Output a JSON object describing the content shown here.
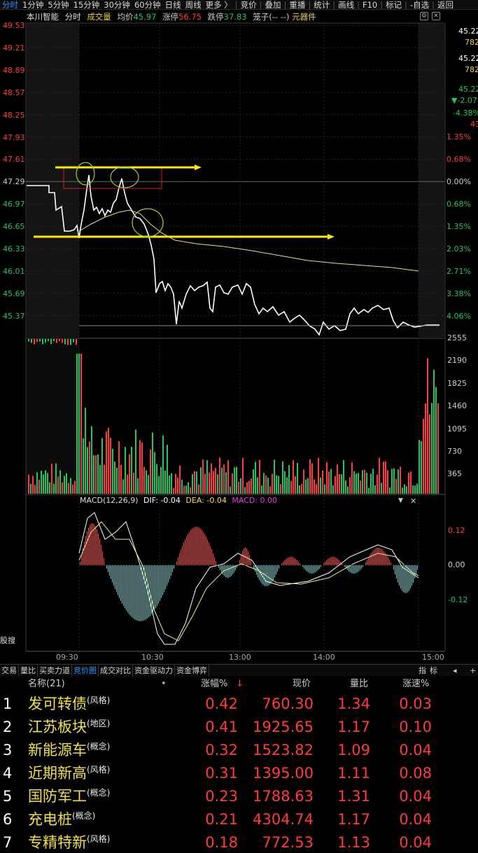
{
  "topbar": {
    "tabs": [
      "分时",
      "1分钟",
      "5分钟",
      "15分钟",
      "30分钟",
      "60分钟",
      "日线",
      "周线",
      "更多 〉",
      "竞价",
      "叠加",
      "重播",
      "统计",
      "画线",
      "F10",
      "标记",
      "-自选",
      "返回"
    ]
  },
  "info": {
    "stock_name": "本川智能",
    "mode": "分时",
    "volume_label": "成交量",
    "avg_label": "均价",
    "avg_value": "45.97",
    "limit_up_label": "涨停",
    "limit_up_value": "56.75",
    "limit_down_label": "跌停",
    "limit_down_value": "37.83",
    "chip_label": "笼子(-- --)",
    "sector": "元器件"
  },
  "price_axis": [
    "49.53",
    "49.21",
    "48.89",
    "48.57",
    "48.25",
    "47.93",
    "47.61",
    "47.29",
    "46.97",
    "46.65",
    "46.33",
    "46.01",
    "45.69",
    "45.37"
  ],
  "pct_axis": [
    "1.35%",
    "0.68%",
    "0.00%",
    "0.68%",
    "1.35%",
    "2.03%",
    "2.71%",
    "3.38%",
    "4.06%"
  ],
  "volume_axis": [
    "2555",
    "2190",
    "1825",
    "1460",
    "1095",
    "730",
    "365"
  ],
  "right_panel": {
    "p1": "45.22",
    "p1_sub": "782",
    "p2": "45.22",
    "p2_sub": "782",
    "p3": "45.22",
    "p3_change": "▼-2.07",
    "p3_pct": "-4.38%",
    "p3_sub": "43"
  },
  "macd": {
    "title": "MACD(12,26,9)",
    "dif_label": "DIF: -0.04",
    "dea_label": "DEA: -0.04",
    "macd_label": "MACD: 0.00",
    "axis": [
      "0.12",
      "0.00",
      "-0.12"
    ]
  },
  "side_label": "股搜",
  "time_axis": [
    "09:30",
    "10:30",
    "13:00",
    "14:00",
    "15:00"
  ],
  "bottom_right_buttons": [
    "指",
    "标"
  ],
  "tabs": [
    "交易",
    "量比",
    "买卖力道",
    "竞价图",
    "成交对比",
    "资金驱动力",
    "资金博弈"
  ],
  "table": {
    "headers": [
      "名称(21)",
      "涨幅%",
      "现价",
      "量比",
      "涨速%"
    ],
    "sort_arrow": "↓",
    "rows": [
      {
        "idx": "1",
        "name": "发可转债",
        "tag": "(风格)",
        "chg": "0.42",
        "price": "760.30",
        "ratio": "1.34",
        "speed": "0.03"
      },
      {
        "idx": "2",
        "name": "江苏板块",
        "tag": "(地区)",
        "chg": "0.41",
        "price": "1925.65",
        "ratio": "1.17",
        "speed": "0.10"
      },
      {
        "idx": "3",
        "name": "新能源车",
        "tag": "(概念)",
        "chg": "0.32",
        "price": "1523.82",
        "ratio": "1.09",
        "speed": "0.04"
      },
      {
        "idx": "4",
        "name": "近期新高",
        "tag": "(风格)",
        "chg": "0.31",
        "price": "1395.00",
        "ratio": "1.11",
        "speed": "0.08"
      },
      {
        "idx": "5",
        "name": "国防军工",
        "tag": "(概念)",
        "chg": "0.23",
        "price": "1788.63",
        "ratio": "1.31",
        "speed": "0.04"
      },
      {
        "idx": "6",
        "name": "充电桩",
        "tag": "(概念)",
        "chg": "0.21",
        "price": "4304.74",
        "ratio": "1.17",
        "speed": "0.04"
      },
      {
        "idx": "7",
        "name": "专精特新",
        "tag": "(风格)",
        "chg": "0.18",
        "price": "772.53",
        "ratio": "1.13",
        "speed": "0.04"
      }
    ]
  },
  "colors": {
    "up": "#ff3b3b",
    "down": "#22c55e",
    "price_line": "#ffffff",
    "avg_line": "#e6e08a",
    "annotation": "#ffea00",
    "accent": "#2f8fff"
  }
}
